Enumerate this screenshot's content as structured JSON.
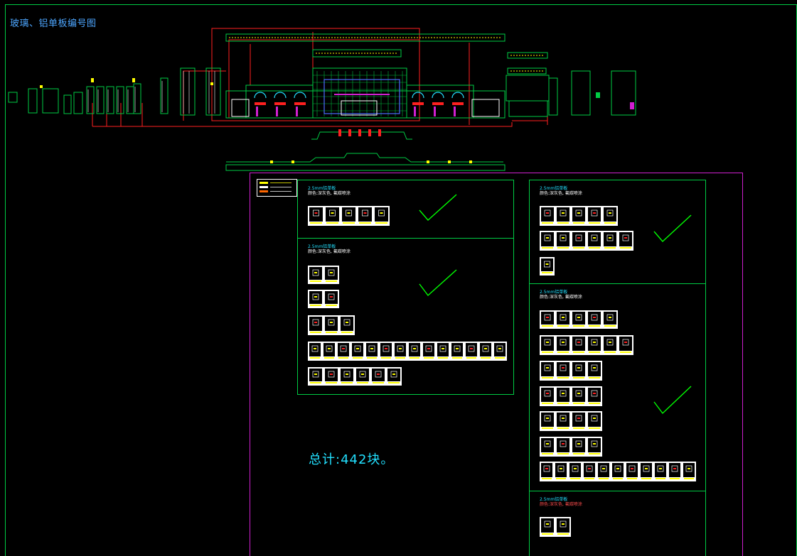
{
  "drawing": {
    "title": "玻璃、铝单板编号图",
    "total_label": "总计:442块。"
  },
  "panels": [
    {
      "name": "2.5mm铝单板",
      "note": "颜色:深灰色, 氟碳喷涂"
    },
    {
      "name": "2.5mm铝单板",
      "note": "颜色:深灰色, 氟碳喷涂"
    },
    {
      "name": "2.5mm铝单板",
      "note": "颜色:深灰色, 氟碳喷涂"
    },
    {
      "name": "2.5mm铝单板",
      "note": "颜色:深灰色, 氟碳喷涂"
    },
    {
      "name": "2.5mm铝单板",
      "note": "颜色:深灰色, 氟碳喷涂"
    }
  ],
  "colors": {
    "frame": "#00cc44",
    "magenta": "#d020d0",
    "red": "#ff2020",
    "check": "#00ff00",
    "cyan": "#22e0ff",
    "yellow": "#ffff00",
    "white": "#ffffff"
  }
}
